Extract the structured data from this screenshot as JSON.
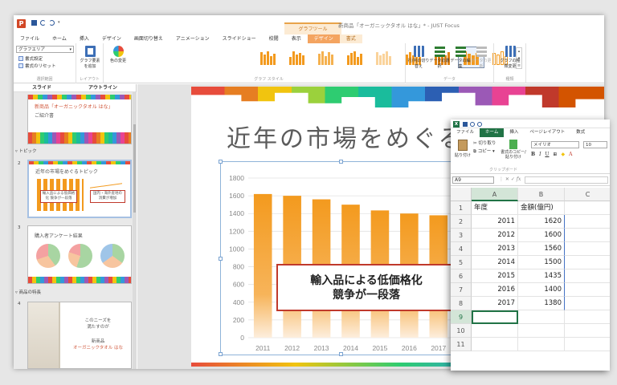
{
  "ppt": {
    "window_title": "新商品「オーガニックタオル はな」* - JUST Focus",
    "tool_context": "グラフツール",
    "tabs": [
      "ファイル",
      "ホーム",
      "挿入",
      "デザイン",
      "画面切り替え",
      "アニメーション",
      "スライドショー",
      "校閲",
      "表示",
      "デザイン",
      "書式"
    ],
    "chart_area_select": "グラフエリア",
    "btn_format_selection": "書式設定",
    "btn_reset_format": "書式のリセット",
    "grp_current_selection": "選択範囲",
    "btn_add_element": "グラフ要素を追加",
    "grp_layout": "レイアウト",
    "btn_change_colors": "色の変更",
    "grp_styles": "グラフ スタイル",
    "btn_switch_rowcol": "行/列の切り替え",
    "btn_select_data": "データの選択",
    "btn_edit_data": "データの編集",
    "btn_refresh_data": "データの更新",
    "grp_data": "データ",
    "btn_change_type": "グラフの種類変更",
    "grp_type": "種類",
    "pane_tab_slide": "スライド",
    "pane_tab_outline": "アウトライン",
    "section_topic": "トピック",
    "section_features": "商品の特長",
    "thumbs": [
      {
        "num": "1",
        "title": "新商品「オーガニックタオル はな」",
        "sub": "ご紹介書"
      },
      {
        "num": "2",
        "title": "近年の市場をめぐるトピック",
        "box1": "輸入品による低価格化 競争が一段落",
        "box2": "国内・海外産地の 消費が増加"
      },
      {
        "num": "3",
        "title": "購入者アンケート結果"
      },
      {
        "num": "4",
        "l1": "このニーズを",
        "l2": "満たすのが",
        "l3": "新商品",
        "l4": "オーガニックタオル はな"
      }
    ],
    "slide_title": "近年の市場をめぐるトピック",
    "callout_line1": "輸入品による低価格化",
    "callout_line2": "競争が一段落"
  },
  "excel": {
    "tabs": [
      "ファイル",
      "ホーム",
      "挿入",
      "ページレイアウト",
      "数式"
    ],
    "btn_paste": "貼り付け",
    "btn_cut": "切り取り",
    "btn_copy": "コピー",
    "btn_format_painter": "書式のコピー/貼り付け",
    "grp_clipboard": "クリップボード",
    "font_name": "メイリオ",
    "font_size": "10",
    "name_box": "A9",
    "columns": [
      "A",
      "B",
      "C"
    ],
    "rows": [
      {
        "num": "1",
        "a": "年度",
        "b": "金額(億円)"
      },
      {
        "num": "2",
        "a": "2011",
        "b": "1620"
      },
      {
        "num": "3",
        "a": "2012",
        "b": "1600"
      },
      {
        "num": "4",
        "a": "2013",
        "b": "1560"
      },
      {
        "num": "5",
        "a": "2014",
        "b": "1500"
      },
      {
        "num": "6",
        "a": "2015",
        "b": "1435"
      },
      {
        "num": "7",
        "a": "2016",
        "b": "1400"
      },
      {
        "num": "8",
        "a": "2017",
        "b": "1380"
      },
      {
        "num": "9",
        "a": "",
        "b": ""
      },
      {
        "num": "10",
        "a": "",
        "b": ""
      },
      {
        "num": "11",
        "a": "",
        "b": ""
      }
    ]
  },
  "chart_data": {
    "type": "bar",
    "categories": [
      "2011",
      "2012",
      "2013",
      "2014",
      "2015",
      "2016",
      "2017"
    ],
    "values": [
      1620,
      1600,
      1560,
      1500,
      1435,
      1400,
      1380
    ],
    "ylim": [
      0,
      1800
    ],
    "yticks": [
      "0",
      "200",
      "400",
      "600",
      "800",
      "1000",
      "1200",
      "1400",
      "1600",
      "1800"
    ],
    "bar_color": "#f39a1e",
    "grid": true
  }
}
